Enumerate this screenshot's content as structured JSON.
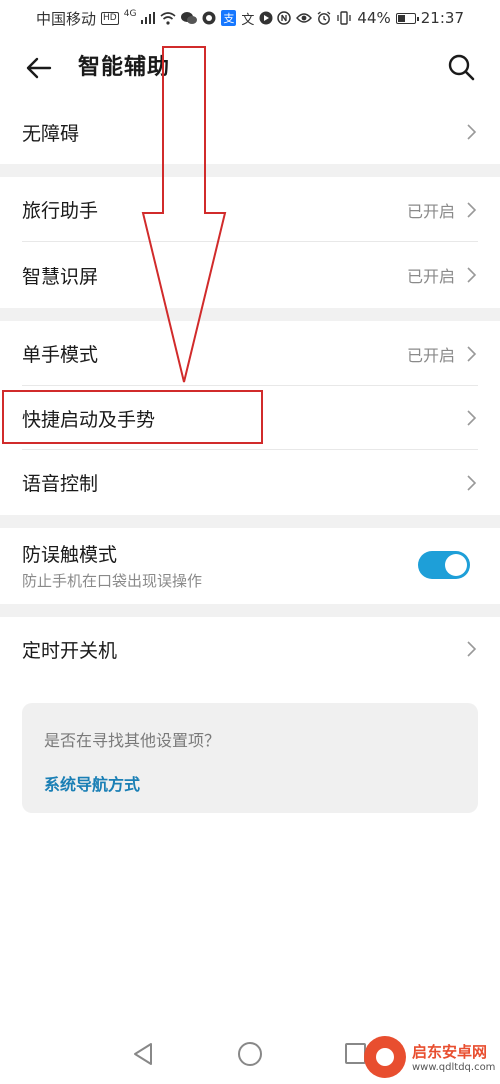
{
  "status_bar": {
    "carrier": "中国移动",
    "network": "4G",
    "hd_badge": "HD",
    "battery_percent": "44%",
    "battery_level": 0.44,
    "time": "21:37",
    "left_icons": [
      "hd-icon",
      "signal-icon",
      "wifi-icon",
      "wechat-icon",
      "app-icon",
      "alipay-icon",
      "translate-icon",
      "record-icon"
    ],
    "right_icons": [
      "nfc-icon",
      "eye-icon",
      "alarm-icon",
      "vibrate-icon",
      "battery-icon"
    ]
  },
  "header": {
    "title": "智能辅助",
    "back_icon": "back-arrow-icon",
    "search_icon": "search-icon"
  },
  "settings": {
    "accessibility": {
      "label": "无障碍"
    },
    "travel_assistant": {
      "label": "旅行助手",
      "value": "已开启"
    },
    "smart_screen": {
      "label": "智慧识屏",
      "value": "已开启"
    },
    "one_hand": {
      "label": "单手模式",
      "value": "已开启"
    },
    "shortcuts": {
      "label": "快捷启动及手势"
    },
    "voice_control": {
      "label": "语音控制"
    },
    "mistouch": {
      "label": "防误触模式",
      "description": "防止手机在口袋出现误操作",
      "enabled": true
    },
    "scheduled_power": {
      "label": "定时开关机"
    }
  },
  "suggestion": {
    "question": "是否在寻找其他设置项？",
    "link": "系统导航方式"
  },
  "nav_bar": {
    "icons": [
      "nav-back-icon",
      "nav-home-icon",
      "nav-recent-icon"
    ]
  },
  "annotation": {
    "arrow_color": "#d12b2b",
    "box_color": "#d12b2b"
  },
  "watermark": {
    "title": "启东安卓网",
    "url": "www.qdltdq.com"
  },
  "colors": {
    "accent": "#1e9fd8",
    "link": "#1a7fb5",
    "section_gap": "#f1f1f1"
  }
}
